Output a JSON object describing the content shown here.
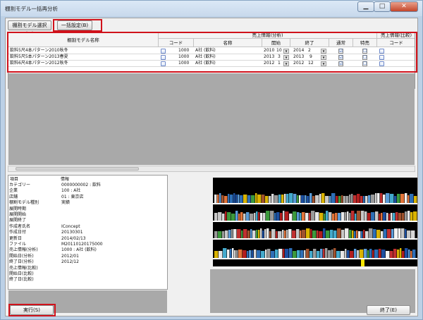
{
  "window": {
    "title": "棚割モデル一括再分析",
    "min_icon": "minimize-icon",
    "max_icon": "maximize-icon",
    "close_icon": "close-icon",
    "min_glyph": "▁",
    "max_glyph": "□",
    "close_glyph": "✕"
  },
  "toolbar": {
    "select_models_label": "棚割モデル選択(M)",
    "bulk_settings_label": "一括設定(B)"
  },
  "grid": {
    "headers": {
      "model_name": "棚割モデル名称",
      "sales_analysis": "売上情報(分析)",
      "code": "コード",
      "name": "名称",
      "start": "開始",
      "end": "終了",
      "normal": "通常",
      "special": "特売",
      "sales_compare": "売上情報(比較)",
      "code2": "コード"
    },
    "rows": [
      {
        "model_name": "飲料5尺4本パターン2010秋冬",
        "code": "1000",
        "name": "A社 (飲料)",
        "start_year": "2010",
        "start_month": "10",
        "end_year": "2014",
        "end_month": "2",
        "normal": "☑",
        "special": "☐"
      },
      {
        "model_name": "飲料5尺5本パターン2013春夏",
        "code": "1000",
        "name": "A社 (飲料)",
        "start_year": "2013",
        "start_month": "3",
        "end_year": "2013",
        "end_month": "9",
        "normal": "☑",
        "special": "☐"
      },
      {
        "model_name": "飲料6尺4本パターン2012秋冬",
        "code": "1000",
        "name": "A社 (飲料)",
        "start_year": "2012",
        "start_month": "1",
        "end_year": "2012",
        "end_month": "12",
        "normal": "☑",
        "special": "☐"
      }
    ]
  },
  "info": {
    "header_key": "項目",
    "header_value": "情報",
    "items": [
      {
        "key": "カテゴリー",
        "value": "0000000002 : 飲料"
      },
      {
        "key": "企業",
        "value": "100 : A社"
      },
      {
        "key": "店舗",
        "value": "01 : 東京店"
      },
      {
        "key": "棚割モデル種別",
        "value": "実績"
      },
      {
        "key": "展開時期",
        "value": ""
      },
      {
        "key": "展開開始",
        "value": ""
      },
      {
        "key": "展開終了",
        "value": ""
      },
      {
        "key": "作成者氏名",
        "value": "IConcept"
      },
      {
        "key": "作成日付",
        "value": "20130301"
      },
      {
        "key": "更新日",
        "value": "2014/02/13"
      },
      {
        "key": "ファイル",
        "value": "M20110120175000"
      },
      {
        "key": "売上情報(分析)",
        "value": "1000 : A社 (飲料)"
      },
      {
        "key": "開始日(分析)",
        "value": "2012/01"
      },
      {
        "key": "終了日(分析)",
        "value": "2012/12"
      },
      {
        "key": "売上情報(比較)",
        "value": ""
      },
      {
        "key": "開始日(比較)",
        "value": ""
      },
      {
        "key": "終了日(比較)",
        "value": ""
      }
    ]
  },
  "footer": {
    "execute_label": "実行(S)",
    "close_label": "終了(E)"
  },
  "colors": {
    "highlight": "#d0121b",
    "shelf_bg": "#000000"
  }
}
